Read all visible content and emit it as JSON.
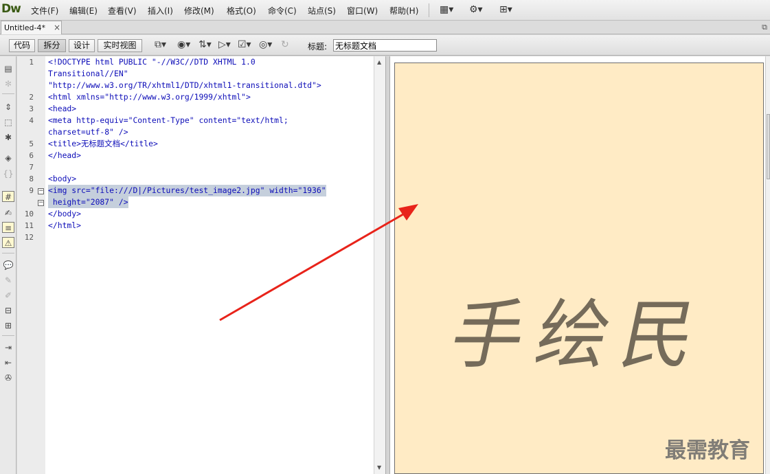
{
  "app": {
    "logo": "Dw"
  },
  "menu": {
    "items": [
      {
        "label": "文件(F)"
      },
      {
        "label": "编辑(E)"
      },
      {
        "label": "查看(V)"
      },
      {
        "label": "插入(I)"
      },
      {
        "label": "修改(M)"
      },
      {
        "label": "格式(O)"
      },
      {
        "label": "命令(C)"
      },
      {
        "label": "站点(S)"
      },
      {
        "label": "窗口(W)"
      },
      {
        "label": "帮助(H)"
      }
    ],
    "icons": [
      "layout-icon",
      "gear-icon",
      "site-icon"
    ]
  },
  "tab": {
    "title": "Untitled-4*",
    "close": "×"
  },
  "toolbar": {
    "views": [
      "代码",
      "拆分",
      "设计",
      "实时视图"
    ],
    "active_view": "拆分",
    "title_label": "标题:",
    "title_value": "无标题文档"
  },
  "editor": {
    "line_numbers": [
      "1",
      "2",
      "3",
      "4",
      "5",
      "6",
      "7",
      "8",
      "9",
      "10",
      "11",
      "12"
    ],
    "lines": [
      "<!DOCTYPE html PUBLIC \"-//W3C//DTD XHTML 1.0",
      "Transitional//EN\"",
      "\"http://www.w3.org/TR/xhtml1/DTD/xhtml1-transitional.dtd\">",
      "<html xmlns=\"http://www.w3.org/1999/xhtml\">",
      "<head>",
      "<meta http-equiv=\"Content-Type\" content=\"text/html;",
      "charset=utf-8\" />",
      "<title>无标题文档</title>",
      "</head>",
      "",
      "<body>",
      "<img src=\"file:///D|/Pictures/test_image2.jpg\" width=\"1936\"",
      " height=\"2087\" />",
      "</body>",
      "</html>",
      ""
    ]
  },
  "design": {
    "image_text": "手绘民",
    "watermark": "最需教育"
  },
  "colors": {
    "code_text": "#0d0db8",
    "selection": "#c5cfdc",
    "design_bg": "#ffebc5",
    "arrow": "#e8231a"
  }
}
